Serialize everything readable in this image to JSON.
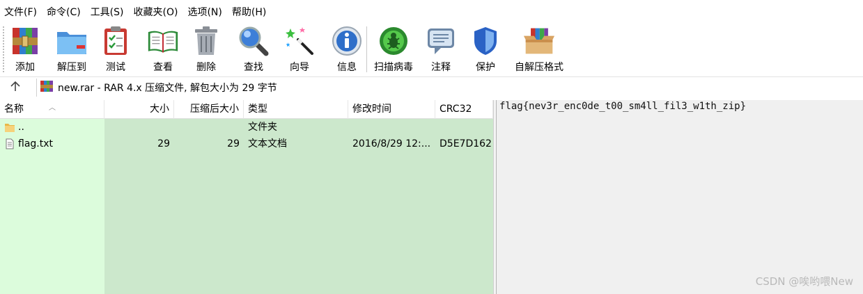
{
  "menu": [
    "文件(F)",
    "命令(C)",
    "工具(S)",
    "收藏夹(O)",
    "选项(N)",
    "帮助(H)"
  ],
  "toolbar": [
    {
      "label": "添加",
      "icon": "add-archive-icon"
    },
    {
      "label": "解压到",
      "icon": "extract-folder-icon"
    },
    {
      "label": "测试",
      "icon": "test-clipboard-icon"
    },
    {
      "label": "查看",
      "icon": "view-book-icon"
    },
    {
      "label": "删除",
      "icon": "trash-icon"
    },
    {
      "label": "查找",
      "icon": "magnifier-icon"
    },
    {
      "label": "向导",
      "icon": "wizard-wand-icon"
    },
    {
      "label": "信息",
      "icon": "info-icon"
    },
    {
      "label": "扫描病毒",
      "icon": "virus-scan-icon"
    },
    {
      "label": "注释",
      "icon": "comment-icon"
    },
    {
      "label": "保护",
      "icon": "shield-icon"
    },
    {
      "label": "自解压格式",
      "icon": "sfx-box-icon"
    }
  ],
  "address": {
    "text": "new.rar - RAR 4.x 压缩文件, 解包大小为 29 字节"
  },
  "columns": [
    "名称",
    "大小",
    "压缩后大小",
    "类型",
    "修改时间",
    "CRC32"
  ],
  "rows": [
    {
      "name": "..",
      "size": "",
      "packed": "",
      "type": "文件夹",
      "modified": "",
      "crc": "",
      "icon": "folder-icon"
    },
    {
      "name": "flag.txt",
      "size": "29",
      "packed": "29",
      "type": "文本文档",
      "modified": "2016/8/29 12:...",
      "crc": "D5E7D162",
      "icon": "text-file-icon"
    }
  ],
  "preview": {
    "content": "flag{nev3r_enc0de_t00_sm4ll_fil3_w1th_zip}"
  },
  "watermark": "CSDN @唉哟喂New",
  "colors": {
    "list_bg": "#dcfcdc",
    "sorted_col_bg": "#cce8cc",
    "preview_bg": "#f0f0f0"
  }
}
